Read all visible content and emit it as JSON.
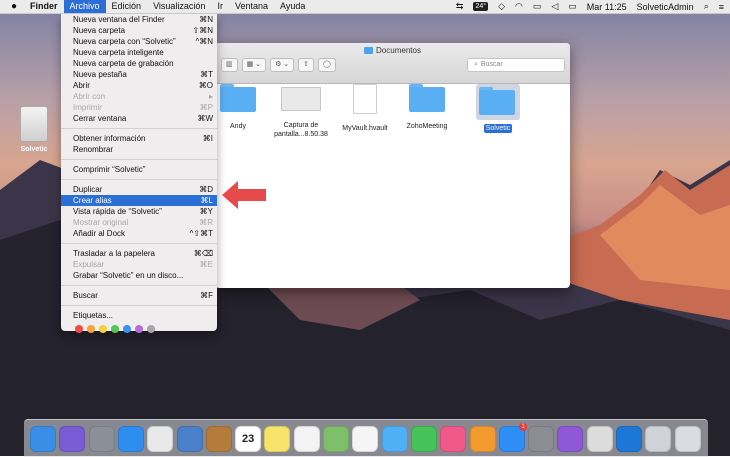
{
  "menubar": {
    "app_name": "Finder",
    "menus": [
      "Archivo",
      "Edición",
      "Visualización",
      "Ir",
      "Ventana",
      "Ayuda"
    ],
    "status_badge": "24°",
    "clock": "Mar 11:25",
    "user": "SolveticAdmin"
  },
  "desktop": {
    "drive_label": "Solvetic"
  },
  "finder": {
    "title": "Documentos",
    "search_placeholder": "Buscar",
    "files": [
      {
        "name": "Andy"
      },
      {
        "name": "Captura de pantalla...8.50.38"
      },
      {
        "name": "MyVault.hvault"
      },
      {
        "name": "ZohoMeeting"
      },
      {
        "name": "Solvetic"
      }
    ]
  },
  "archivo_menu": {
    "items": [
      {
        "label": "Nueva ventana del Finder",
        "shortcut": "⌘N"
      },
      {
        "label": "Nueva carpeta",
        "shortcut": "⇧⌘N"
      },
      {
        "label": "Nueva carpeta con “Solvetic”",
        "shortcut": "^⌘N"
      },
      {
        "label": "Nueva carpeta inteligente",
        "shortcut": ""
      },
      {
        "label": "Nueva carpeta de grabación",
        "shortcut": ""
      },
      {
        "label": "Nueva pestaña",
        "shortcut": "⌘T"
      },
      {
        "label": "Abrir",
        "shortcut": "⌘O"
      },
      {
        "label": "Abrir con",
        "shortcut": "▸"
      },
      {
        "label": "Imprimir",
        "shortcut": "⌘P"
      },
      {
        "label": "Cerrar ventana",
        "shortcut": "⌘W"
      },
      {
        "label": "Obtener información",
        "shortcut": "⌘I"
      },
      {
        "label": "Renombrar",
        "shortcut": ""
      },
      {
        "label": "Comprimir “Solvetic”",
        "shortcut": ""
      },
      {
        "label": "Duplicar",
        "shortcut": "⌘D"
      },
      {
        "label": "Crear alias",
        "shortcut": "⌘L"
      },
      {
        "label": "Vista rápida de “Solvetic”",
        "shortcut": "⌘Y"
      },
      {
        "label": "Mostrar original",
        "shortcut": "⌘R"
      },
      {
        "label": "Añadir al Dock",
        "shortcut": "^⇧⌘T"
      },
      {
        "label": "Trasladar a la papelera",
        "shortcut": "⌘⌫"
      },
      {
        "label": "Expulsar",
        "shortcut": "⌘E"
      },
      {
        "label": "Grabar “Solvetic” en un disco...",
        "shortcut": ""
      },
      {
        "label": "Buscar",
        "shortcut": "⌘F"
      },
      {
        "label": "Etiquetas...",
        "shortcut": ""
      }
    ],
    "tag_colors": [
      "#ee4b47",
      "#f5a23a",
      "#f4d23e",
      "#5ac24f",
      "#3d8ef5",
      "#b86bd9",
      "#a6a6a6"
    ]
  },
  "colors": {
    "highlight": "#2b6fd6",
    "arrow": "#e64a4a"
  },
  "dock_icons": [
    "finder-icon",
    "siri-icon",
    "launchpad-icon",
    "safari-icon",
    "chrome-icon",
    "preview-icon",
    "notes-book-icon",
    "calendar-icon",
    "notes-icon",
    "reminders-icon",
    "maps-icon",
    "photos-icon",
    "messages-icon",
    "facetime-icon",
    "itunes-icon",
    "ibooks-icon",
    "app-store-icon",
    "system-preferences-icon",
    "feedback-icon",
    "archive-icon",
    "teamviewer-icon",
    "downloads-icon",
    "trash-icon"
  ],
  "calendar_day": "23",
  "app_store_badge": "1"
}
